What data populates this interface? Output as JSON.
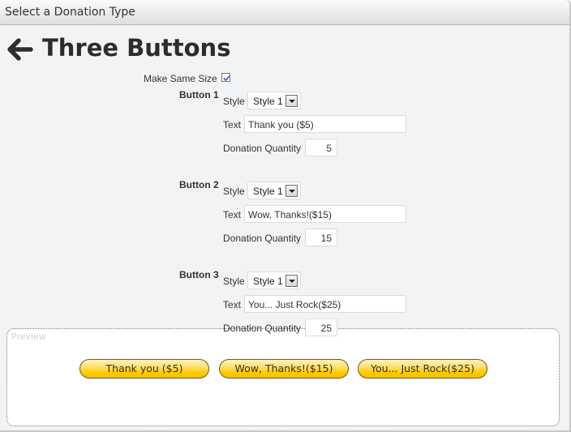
{
  "window": {
    "title": "Select a Donation Type"
  },
  "header": {
    "back_icon": "arrow-left-icon",
    "title": "Three Buttons"
  },
  "options": {
    "make_same_size_label": "Make Same Size",
    "make_same_size_checked": true
  },
  "field_labels": {
    "style": "Style",
    "text": "Text",
    "quantity": "Donation Quantity"
  },
  "buttons": [
    {
      "label": "Button 1",
      "style": "Style 1",
      "text": "Thank you ($5)",
      "quantity": "5"
    },
    {
      "label": "Button 2",
      "style": "Style 1",
      "text": "Wow, Thanks!($15)",
      "quantity": "15"
    },
    {
      "label": "Button 3",
      "style": "Style 1",
      "text": "You... Just Rock($25)",
      "quantity": "25"
    }
  ],
  "preview": {
    "legend": "Preview",
    "buttons": [
      "Thank you ($5)",
      "Wow, Thanks!($15)",
      "You... Just Rock($25)"
    ],
    "button_color": "#ffcc00"
  }
}
